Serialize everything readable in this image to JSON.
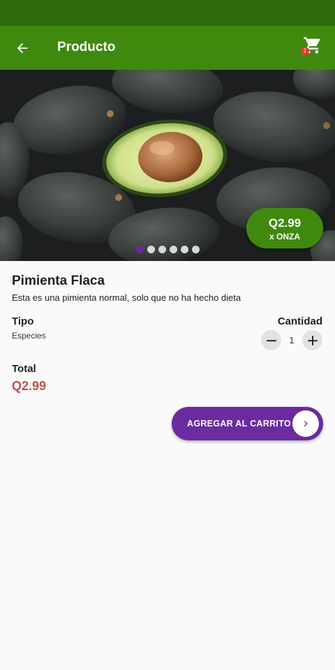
{
  "app_bar": {
    "title": "Producto",
    "back_icon": "arrow-left-icon",
    "cart_icon": "shopping-cart-icon",
    "cart_badge": "1"
  },
  "hero": {
    "image": "avocados-photo",
    "price": "Q2.99",
    "unit": "x ONZA",
    "carousel": {
      "count": 6,
      "active": 0
    }
  },
  "product": {
    "name": "Pimienta Flaca",
    "description": "Esta es una pimienta normal, solo que no ha hecho dieta",
    "type_label": "Tipo",
    "type_value": "Especies",
    "quantity_label": "Cantidad",
    "quantity": "1",
    "total_label": "Total",
    "total_value": "Q2.99"
  },
  "actions": {
    "add_to_cart": "AGREGAR AL CARRITO"
  },
  "colors": {
    "status_bar": "#2f6b0b",
    "app_bar": "#3f8a0e",
    "accent_purple": "#6a2c9e",
    "total_red": "#c0504d"
  }
}
